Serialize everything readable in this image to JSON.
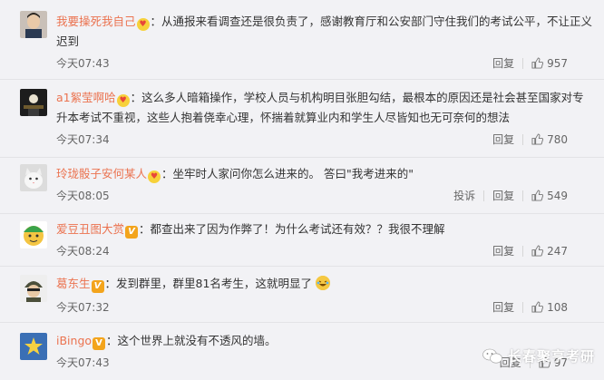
{
  "comments": [
    {
      "username": "我要操死我自己",
      "badge": "heart",
      "colon": "：",
      "text": "从通报来看调查还是很负责了，感谢教育厅和公安部门守住我们的考试公平，不让正义迟到",
      "time": "今天07:43",
      "actions": [
        "回复"
      ],
      "likes": "957",
      "avatar": "person-avatar"
    },
    {
      "username": "a1絮莹啊哈",
      "badge": "heart",
      "colon": "：",
      "text": "这么多人暗箱操作，学校人员与机构明目张胆勾结，最根本的原因还是社会甚至国家对专升本考试不重视，这些人抱着侥幸心理，怀揣着就算业内和学生人尽皆知也无可奈何的想法",
      "time": "今天07:34",
      "actions": [
        "回复"
      ],
      "likes": "780",
      "avatar": "dark-avatar"
    },
    {
      "username": "玲珑骰子安何某人",
      "badge": "heart",
      "colon": "：",
      "text": "坐牢时人家问你怎么进来的。 答曰\"我考进来的\"",
      "time": "今天08:05",
      "actions": [
        "投诉",
        "回复"
      ],
      "likes": "549",
      "avatar": "cat-avatar"
    },
    {
      "username": "爱豆丑图大赏",
      "badge": "v",
      "colon": "：",
      "text": "都查出来了因为作弊了！为什么考试还有效？？我很不理解",
      "time": "今天08:24",
      "actions": [
        "回复"
      ],
      "likes": "247",
      "avatar": "cartoon-avatar"
    },
    {
      "username": "葛东生",
      "badge": "v",
      "colon": "：",
      "text": "发到群里，群里81名考生，这就明显了",
      "time": "今天07:32",
      "actions": [
        "回复"
      ],
      "likes": "108",
      "avatar": "soldier-avatar",
      "emoji": "laughing-crying-emoji"
    },
    {
      "username": "iBingo",
      "badge": "v",
      "colon": "：",
      "text": "这个世界上就没有不透风的墙。",
      "time": "今天07:43",
      "actions": [
        "回复"
      ],
      "likes": "97",
      "avatar": "star-avatar"
    }
  ],
  "watermark": {
    "text": "长春聚亨考研"
  },
  "colors": {
    "username": "#eb7350",
    "background": "#f2f2f5",
    "badge_v": "#f3a41c"
  }
}
